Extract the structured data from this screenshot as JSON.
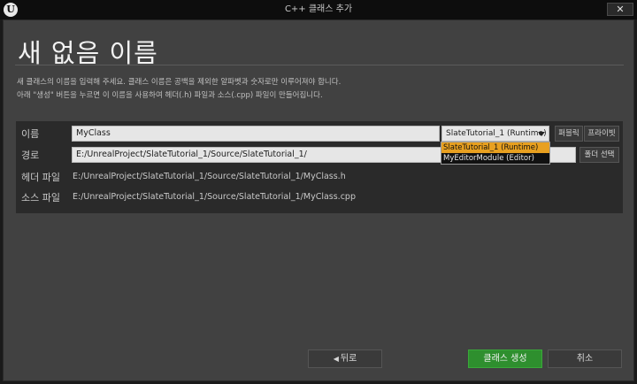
{
  "window": {
    "title": "C++ 클래스 추가",
    "logo": "U",
    "close_glyph": "✕"
  },
  "page": {
    "title": "새 없음 이름",
    "description_line1": "새 클래스의 이름을 입력해 주세요. 클래스 이름은 공백을 제외한 알파벳과 숫자로만 이루어져야 합니다.",
    "description_line2": "아래 \"생성\" 버튼을 누르면 이 이름을 사용하여 헤더(.h) 파일과 소스(.cpp) 파일이 만들어집니다."
  },
  "form": {
    "name_label": "이름",
    "name_value": "MyClass",
    "path_label": "경로",
    "path_value": "E:/UnrealProject/SlateTutorial_1/Source/SlateTutorial_1/",
    "header_label": "헤더 파일",
    "header_value": "E:/UnrealProject/SlateTutorial_1/Source/SlateTutorial_1/MyClass.h",
    "source_label": "소스 파일",
    "source_value": "E:/UnrealProject/SlateTutorial_1/Source/SlateTutorial_1/MyClass.cpp",
    "module_selected": "SlateTutorial_1 (Runtime)",
    "module_options": [
      "SlateTutorial_1 (Runtime)",
      "MyEditorModule (Editor)"
    ],
    "public_label": "퍼블릭",
    "private_label": "프라이빗",
    "choose_folder_label": "폴더 선택"
  },
  "buttons": {
    "back_label": "뒤로",
    "back_arrow": "◀",
    "create_label": "클래스 생성",
    "cancel_label": "취소"
  },
  "colors": {
    "accent_selected": "#e8a020",
    "create_button": "#2e8f2e"
  }
}
